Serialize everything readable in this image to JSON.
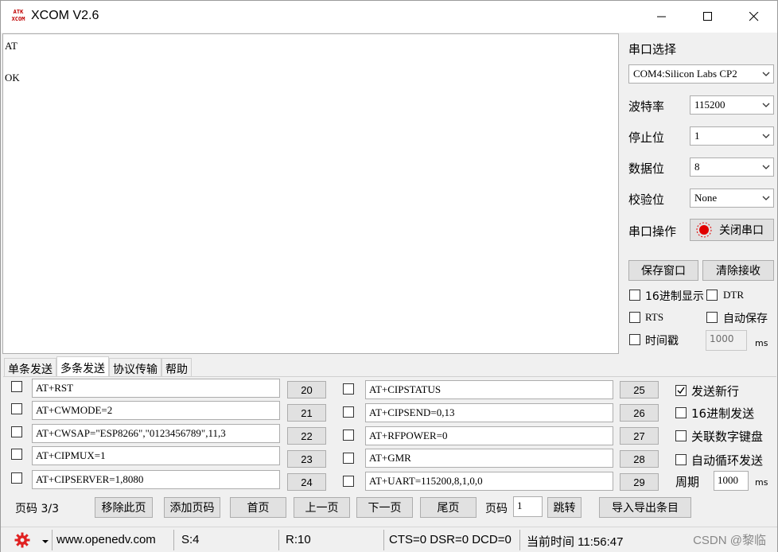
{
  "window": {
    "title": "XCOM V2.6",
    "logo_text": "ATK XCOM"
  },
  "receive": {
    "lines": [
      "AT",
      "",
      "OK"
    ]
  },
  "settings": {
    "port_select_label": "串口选择",
    "port_value": "COM4:Silicon Labs CP2",
    "baud_label": "波特率",
    "baud_value": "115200",
    "stopbits_label": "停止位",
    "stopbits_value": "1",
    "databits_label": "数据位",
    "databits_value": "8",
    "parity_label": "校验位",
    "parity_value": "None",
    "port_op_label": "串口操作",
    "close_port_button": "关闭串口",
    "save_window_button": "保存窗口",
    "clear_recv_button": "清除接收",
    "hex_display_label": "16进制显示",
    "dtr_label": "DTR",
    "rts_label": "RTS",
    "auto_save_label": "自动保存",
    "timestamp_label": "时间戳",
    "timestamp_value": "1000",
    "timestamp_unit": "ms"
  },
  "tabs": [
    "单条发送",
    "多条发送",
    "协议传输",
    "帮助"
  ],
  "multi_send": {
    "left": [
      {
        "cmd": "AT+RST",
        "btn": "20"
      },
      {
        "cmd": "AT+CWMODE=2",
        "btn": "21"
      },
      {
        "cmd": "AT+CWSAP=\"ESP8266\",\"0123456789\",11,3",
        "btn": "22"
      },
      {
        "cmd": "AT+CIPMUX=1",
        "btn": "23"
      },
      {
        "cmd": "AT+CIPSERVER=1,8080",
        "btn": "24"
      }
    ],
    "right": [
      {
        "cmd": "AT+CIPSTATUS",
        "btn": "25"
      },
      {
        "cmd": "AT+CIPSEND=0,13",
        "btn": "26"
      },
      {
        "cmd": "AT+RFPOWER=0",
        "btn": "27"
      },
      {
        "cmd": "AT+GMR",
        "btn": "28"
      },
      {
        "cmd": "AT+UART=115200,8,1,0,0",
        "btn": "29"
      }
    ],
    "send_newline_label": "发送新行",
    "hex_send_label": "16进制发送",
    "keypad_label": "关联数字键盘",
    "auto_loop_label": "自动循环发送",
    "period_label": "周期",
    "period_value": "1000",
    "period_unit": "ms",
    "page_label": "页码 3/3",
    "remove_page": "移除此页",
    "add_page": "添加页码",
    "first_page": "首页",
    "prev_page": "上一页",
    "next_page": "下一页",
    "last_page": "尾页",
    "page_input_label": "页码",
    "page_input_value": "1",
    "jump": "跳转",
    "import_export": "导入导出条目"
  },
  "statusbar": {
    "url": "www.openedv.com",
    "sent": "S:4",
    "received": "R:10",
    "lines": "CTS=0 DSR=0 DCD=0",
    "time": "当前时间 11:56:47",
    "watermark": "CSDN @黎临"
  },
  "colors": {
    "indicator_red": "#e00000",
    "gear_red": "#e02020"
  }
}
